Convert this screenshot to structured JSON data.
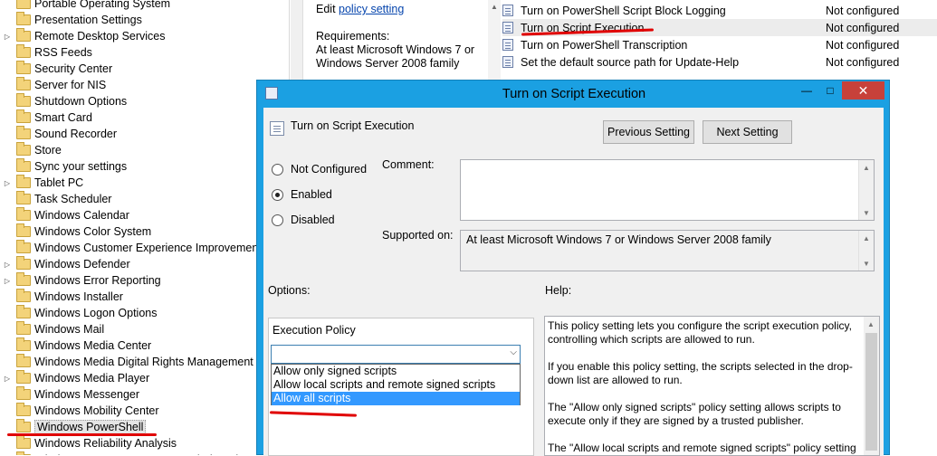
{
  "tree": {
    "items": [
      {
        "label": "Portable Operating System",
        "expander": ""
      },
      {
        "label": "Presentation Settings",
        "expander": ""
      },
      {
        "label": "Remote Desktop Services",
        "expander": "▷"
      },
      {
        "label": "RSS Feeds",
        "expander": ""
      },
      {
        "label": "Security Center",
        "expander": ""
      },
      {
        "label": "Server for NIS",
        "expander": ""
      },
      {
        "label": "Shutdown Options",
        "expander": ""
      },
      {
        "label": "Smart Card",
        "expander": ""
      },
      {
        "label": "Sound Recorder",
        "expander": ""
      },
      {
        "label": "Store",
        "expander": ""
      },
      {
        "label": "Sync your settings",
        "expander": ""
      },
      {
        "label": "Tablet PC",
        "expander": "▷"
      },
      {
        "label": "Task Scheduler",
        "expander": ""
      },
      {
        "label": "Windows Calendar",
        "expander": ""
      },
      {
        "label": "Windows Color System",
        "expander": ""
      },
      {
        "label": "Windows Customer Experience Improvement P",
        "expander": ""
      },
      {
        "label": "Windows Defender",
        "expander": "▷"
      },
      {
        "label": "Windows Error Reporting",
        "expander": "▷"
      },
      {
        "label": "Windows Installer",
        "expander": ""
      },
      {
        "label": "Windows Logon Options",
        "expander": ""
      },
      {
        "label": "Windows Mail",
        "expander": ""
      },
      {
        "label": "Windows Media Center",
        "expander": ""
      },
      {
        "label": "Windows Media Digital Rights Management",
        "expander": ""
      },
      {
        "label": "Windows Media Player",
        "expander": "▷"
      },
      {
        "label": "Windows Messenger",
        "expander": ""
      },
      {
        "label": "Windows Mobility Center",
        "expander": ""
      },
      {
        "label": "Windows PowerShell",
        "expander": ""
      },
      {
        "label": "Windows Reliability Analysis",
        "expander": ""
      },
      {
        "label": "Windows Remote Management (WinRM)",
        "expander": "▷"
      }
    ],
    "selected_label": "Windows PowerShell"
  },
  "explain": {
    "edit_prefix": "Edit",
    "edit_link": "policy setting",
    "requirements_label": "Requirements:",
    "requirements_text": "At least Microsoft Windows 7 or Windows Server 2008 family"
  },
  "settings_list": [
    {
      "name": "Turn on PowerShell Script Block Logging",
      "state": "Not configured"
    },
    {
      "name": "Turn on Script Execution",
      "state": "Not configured"
    },
    {
      "name": "Turn on PowerShell Transcription",
      "state": "Not configured"
    },
    {
      "name": "Set the default source path for Update-Help",
      "state": "Not configured"
    }
  ],
  "dialog": {
    "title": "Turn on Script Execution",
    "heading": "Turn on Script Execution",
    "min_glyph": "—",
    "max_glyph": "□",
    "close_glyph": "✕",
    "previous_button": "Previous Setting",
    "next_button": "Next Setting",
    "radio_not_configured": "Not Configured",
    "radio_enabled": "Enabled",
    "radio_disabled": "Disabled",
    "selected_radio": "Enabled",
    "comment_label": "Comment:",
    "comment_value": "",
    "supported_label": "Supported on:",
    "supported_value": "At least Microsoft Windows 7 or Windows Server 2008 family",
    "options_label": "Options:",
    "help_label": "Help:",
    "execution_policy_label": "Execution Policy",
    "execution_policy_value": "",
    "dropdown_options": [
      "Allow only signed scripts",
      "Allow local scripts and remote signed scripts",
      "Allow all scripts"
    ],
    "highlighted_option": "Allow all scripts",
    "help_paragraphs": [
      "This policy setting lets you configure the script execution policy, controlling which scripts are allowed to run.",
      "If you enable this policy setting, the scripts selected in the drop-down list are allowed to run.",
      "The \"Allow only signed scripts\" policy setting allows scripts to execute only if they are signed by a trusted publisher.",
      "The \"Allow local scripts and remote signed scripts\" policy setting"
    ]
  },
  "colors": {
    "title_bar": "#1ba0e2",
    "close_button": "#c7413a",
    "annotation_red": "#e00000",
    "dropdown_highlight": "#3399ff"
  }
}
